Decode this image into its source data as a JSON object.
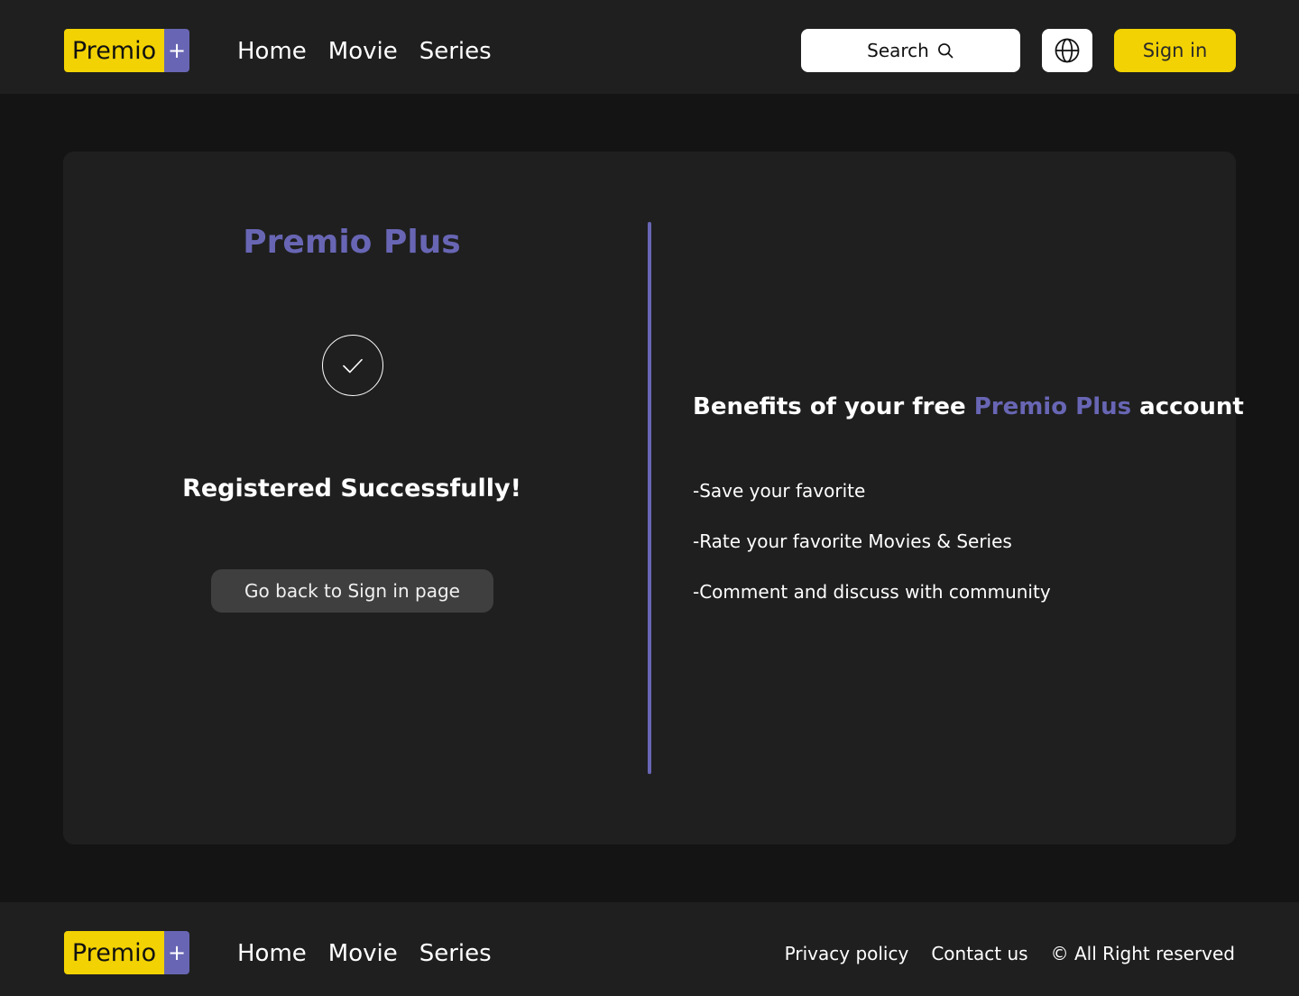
{
  "header": {
    "logo_word": "Premio",
    "logo_plus": "+",
    "nav": [
      "Home",
      "Movie",
      "Series"
    ],
    "search_label": "Search",
    "search_icon": "search-icon",
    "globe_icon": "globe-icon",
    "signin_label": "Sign in"
  },
  "main": {
    "brand_title": "Premio Plus",
    "check_icon": "check-circle-icon",
    "success_message": "Registered Successfully!",
    "back_button_label": "Go back to Sign in page",
    "benefits": {
      "title_prefix": "Benefits of your free ",
      "title_accent": "Premio Plus",
      "title_suffix": " account",
      "items": [
        "-Save your favorite",
        "-Rate your favorite Movies & Series",
        "-Comment and discuss with community"
      ]
    }
  },
  "footer": {
    "logo_word": "Premio",
    "logo_plus": "+",
    "nav": [
      "Home",
      "Movie",
      "Series"
    ],
    "privacy_label": "Privacy policy",
    "contact_label": "Contact us",
    "rights_label": "© All Right reserved"
  },
  "colors": {
    "brand_yellow": "#f2d202",
    "brand_purple": "#6866b4",
    "page_bg": "#141414",
    "panel_bg": "#1f1f1f"
  }
}
